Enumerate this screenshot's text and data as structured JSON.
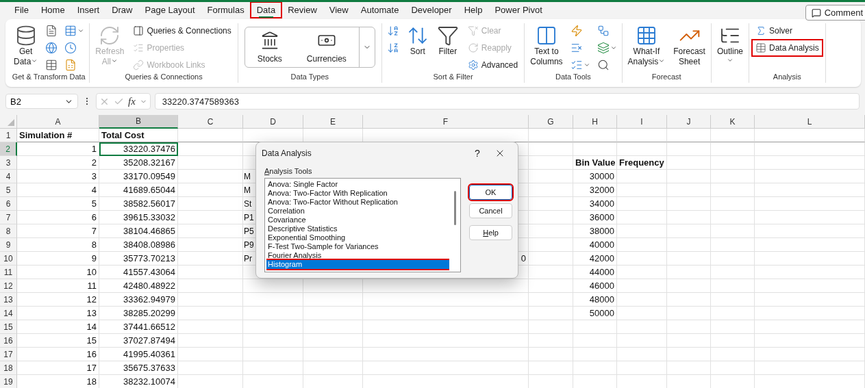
{
  "menu_tabs": [
    {
      "label": "File",
      "selected": false,
      "annotated": false
    },
    {
      "label": "Home",
      "selected": false,
      "annotated": false
    },
    {
      "label": "Insert",
      "selected": false,
      "annotated": false
    },
    {
      "label": "Draw",
      "selected": false,
      "annotated": false
    },
    {
      "label": "Page Layout",
      "selected": false,
      "annotated": false
    },
    {
      "label": "Formulas",
      "selected": false,
      "annotated": false
    },
    {
      "label": "Data",
      "selected": true,
      "annotated": true
    },
    {
      "label": "Review",
      "selected": false,
      "annotated": false
    },
    {
      "label": "View",
      "selected": false,
      "annotated": false
    },
    {
      "label": "Automate",
      "selected": false,
      "annotated": false
    },
    {
      "label": "Developer",
      "selected": false,
      "annotated": false
    },
    {
      "label": "Help",
      "selected": false,
      "annotated": false
    },
    {
      "label": "Power Pivot",
      "selected": false,
      "annotated": false
    }
  ],
  "comments_button": {
    "label": "Comment"
  },
  "ribbon": {
    "groups": [
      {
        "title": "Get & Transform Data",
        "columns": [
          [
            {
              "kind": "large",
              "lines": [
                "Get",
                "Data"
              ],
              "dropdown": true,
              "disabled": false
            }
          ],
          [
            {
              "kind": "icon"
            },
            {
              "kind": "icon"
            },
            {
              "kind": "icon"
            }
          ],
          [
            {
              "kind": "icon",
              "dropdown": true
            },
            {
              "kind": "icon"
            },
            {
              "kind": "icon"
            }
          ]
        ]
      },
      {
        "title": "Queries & Connections",
        "columns": [
          [
            {
              "kind": "large",
              "lines": [
                "Refresh",
                "All"
              ],
              "dropdown": true,
              "disabled": true
            }
          ],
          [
            {
              "kind": "small",
              "label": "Queries & Connections",
              "disabled": false,
              "annotated": false
            },
            {
              "kind": "small",
              "label": "Properties",
              "disabled": true,
              "annotated": false
            },
            {
              "kind": "small",
              "label": "Workbook Links",
              "disabled": true,
              "annotated": false
            }
          ]
        ]
      },
      {
        "title": "Data Types",
        "columns": [
          [
            {
              "kind": "gallery",
              "items": [
                "Stocks",
                "Currencies"
              ]
            }
          ]
        ]
      },
      {
        "title": "Sort & Filter",
        "columns": [
          [
            {
              "kind": "icon"
            },
            {
              "kind": "icon"
            }
          ],
          [
            {
              "kind": "large",
              "lines": [
                "Sort"
              ],
              "disabled": false
            }
          ],
          [
            {
              "kind": "large",
              "lines": [
                "Filter"
              ],
              "disabled": false
            }
          ],
          [
            {
              "kind": "small",
              "label": "Clear",
              "disabled": true,
              "annotated": false
            },
            {
              "kind": "small",
              "label": "Reapply",
              "disabled": true,
              "annotated": false
            },
            {
              "kind": "small",
              "label": "Advanced",
              "disabled": false,
              "annotated": false
            }
          ]
        ]
      },
      {
        "title": "Data Tools",
        "columns": [
          [
            {
              "kind": "large",
              "lines": [
                "Text to",
                "Columns"
              ],
              "disabled": false
            }
          ],
          [
            {
              "kind": "icon"
            },
            {
              "kind": "icon"
            },
            {
              "kind": "icon",
              "dropdown": true
            }
          ],
          [
            {
              "kind": "icon"
            },
            {
              "kind": "icon",
              "dropdown": true
            },
            {
              "kind": "icon"
            }
          ]
        ]
      },
      {
        "title": "Forecast",
        "columns": [
          [
            {
              "kind": "large",
              "lines": [
                "What-If",
                "Analysis"
              ],
              "dropdown": true,
              "disabled": false
            }
          ],
          [
            {
              "kind": "large",
              "lines": [
                "Forecast",
                "Sheet"
              ],
              "disabled": false
            }
          ]
        ]
      },
      {
        "columns": [
          [
            {
              "kind": "large_menu",
              "lines": [
                "Outline"
              ],
              "dropdown": true,
              "disabled": false
            }
          ]
        ]
      },
      {
        "title": "Analysis",
        "columns": [
          [
            {
              "kind": "small",
              "label": "Solver",
              "disabled": false,
              "annotated": false
            },
            {
              "kind": "small",
              "label": "Data Analysis",
              "disabled": false,
              "annotated": true
            }
          ]
        ]
      }
    ]
  },
  "formula_bar": {
    "name_box": "B2",
    "function_label": "fx",
    "value": "33220.3747589363"
  },
  "grid": {
    "columns": [
      {
        "label": "A",
        "selected": false
      },
      {
        "label": "B",
        "selected": true
      },
      {
        "label": "C",
        "selected": false
      },
      {
        "label": "D",
        "selected": false
      },
      {
        "label": "E",
        "selected": false
      },
      {
        "label": "F",
        "selected": false
      },
      {
        "label": "G",
        "selected": false
      },
      {
        "label": "H",
        "selected": false
      },
      {
        "label": "I",
        "selected": false
      },
      {
        "label": "J",
        "selected": false
      },
      {
        "label": "K",
        "selected": false
      },
      {
        "label": "L",
        "selected": false
      }
    ],
    "rows": [
      {
        "number": "1",
        "selected": false,
        "cells": {
          "A": {
            "text": "Simulation #",
            "kind": "header"
          },
          "B": {
            "text": "Total Cost",
            "kind": "header"
          }
        }
      },
      {
        "number": "2",
        "selected": true,
        "cells": {
          "A": "1",
          "B": "33220.37476"
        }
      },
      {
        "number": "3",
        "selected": false,
        "cells": {
          "A": "2",
          "B": "35208.32167",
          "H": {
            "text": "Bin Value",
            "kind": "header"
          },
          "I": {
            "text": "Frequency",
            "kind": "header"
          }
        }
      },
      {
        "number": "4",
        "selected": false,
        "cells": {
          "A": "3",
          "B": "33170.09549",
          "D": {
            "text": "M",
            "kind": "label"
          },
          "H": "30000"
        }
      },
      {
        "number": "5",
        "selected": false,
        "cells": {
          "A": "4",
          "B": "41689.65044",
          "D": {
            "text": "M",
            "kind": "label"
          },
          "H": "32000"
        }
      },
      {
        "number": "6",
        "selected": false,
        "cells": {
          "A": "5",
          "B": "38582.56017",
          "D": {
            "text": "St",
            "kind": "label"
          },
          "H": "34000"
        }
      },
      {
        "number": "7",
        "selected": false,
        "cells": {
          "A": "6",
          "B": "39615.33032",
          "D": {
            "text": "P1",
            "kind": "label"
          },
          "H": "36000"
        }
      },
      {
        "number": "8",
        "selected": false,
        "cells": {
          "A": "7",
          "B": "38104.46865",
          "D": {
            "text": "P5",
            "kind": "label"
          },
          "H": "38000"
        }
      },
      {
        "number": "9",
        "selected": false,
        "cells": {
          "A": "8",
          "B": "38408.08986",
          "D": {
            "text": "P9",
            "kind": "label"
          },
          "H": "40000"
        }
      },
      {
        "number": "10",
        "selected": false,
        "cells": {
          "A": "9",
          "B": "35773.70213",
          "D": {
            "text": "Pr",
            "kind": "label"
          },
          "F": "0",
          "H": "42000"
        }
      },
      {
        "number": "11",
        "selected": false,
        "cells": {
          "A": "10",
          "B": "41557.43064",
          "H": "44000"
        }
      },
      {
        "number": "12",
        "selected": false,
        "cells": {
          "A": "11",
          "B": "42480.48922",
          "H": "46000"
        }
      },
      {
        "number": "13",
        "selected": false,
        "cells": {
          "A": "12",
          "B": "33362.94979",
          "H": "48000"
        }
      },
      {
        "number": "14",
        "selected": false,
        "cells": {
          "A": "13",
          "B": "38285.20299",
          "H": "50000"
        }
      },
      {
        "number": "15",
        "selected": false,
        "cells": {
          "A": "14",
          "B": "37441.66512"
        }
      },
      {
        "number": "16",
        "selected": false,
        "cells": {
          "A": "15",
          "B": "37027.87494"
        }
      },
      {
        "number": "17",
        "selected": false,
        "cells": {
          "A": "16",
          "B": "41995.40361"
        }
      },
      {
        "number": "18",
        "selected": false,
        "cells": {
          "A": "17",
          "B": "35675.37633"
        }
      },
      {
        "number": "19",
        "selected": false,
        "cells": {
          "A": "18",
          "B": "38232.10074"
        }
      }
    ]
  },
  "dialog": {
    "title": "Data Analysis",
    "help_glyph": "?",
    "list_label": "Analysis Tools",
    "tools": [
      {
        "label": "Anova: Single Factor",
        "selected": false,
        "annotated": false
      },
      {
        "label": "Anova: Two-Factor With Replication",
        "selected": false,
        "annotated": false
      },
      {
        "label": "Anova: Two-Factor Without Replication",
        "selected": false,
        "annotated": false
      },
      {
        "label": "Correlation",
        "selected": false,
        "annotated": false
      },
      {
        "label": "Covariance",
        "selected": false,
        "annotated": false
      },
      {
        "label": "Descriptive Statistics",
        "selected": false,
        "annotated": false
      },
      {
        "label": "Exponential Smoothing",
        "selected": false,
        "annotated": false
      },
      {
        "label": "F-Test Two-Sample for Variances",
        "selected": false,
        "annotated": false
      },
      {
        "label": "Fourier Analysis",
        "selected": false,
        "annotated": false
      },
      {
        "label": "Histogram",
        "selected": true,
        "annotated": true
      }
    ],
    "buttons": [
      {
        "label": "OK",
        "default": true,
        "annotated": true
      },
      {
        "label": "Cancel",
        "default": false,
        "annotated": false
      },
      {
        "label": "Help",
        "default": false,
        "annotated": false
      }
    ]
  }
}
